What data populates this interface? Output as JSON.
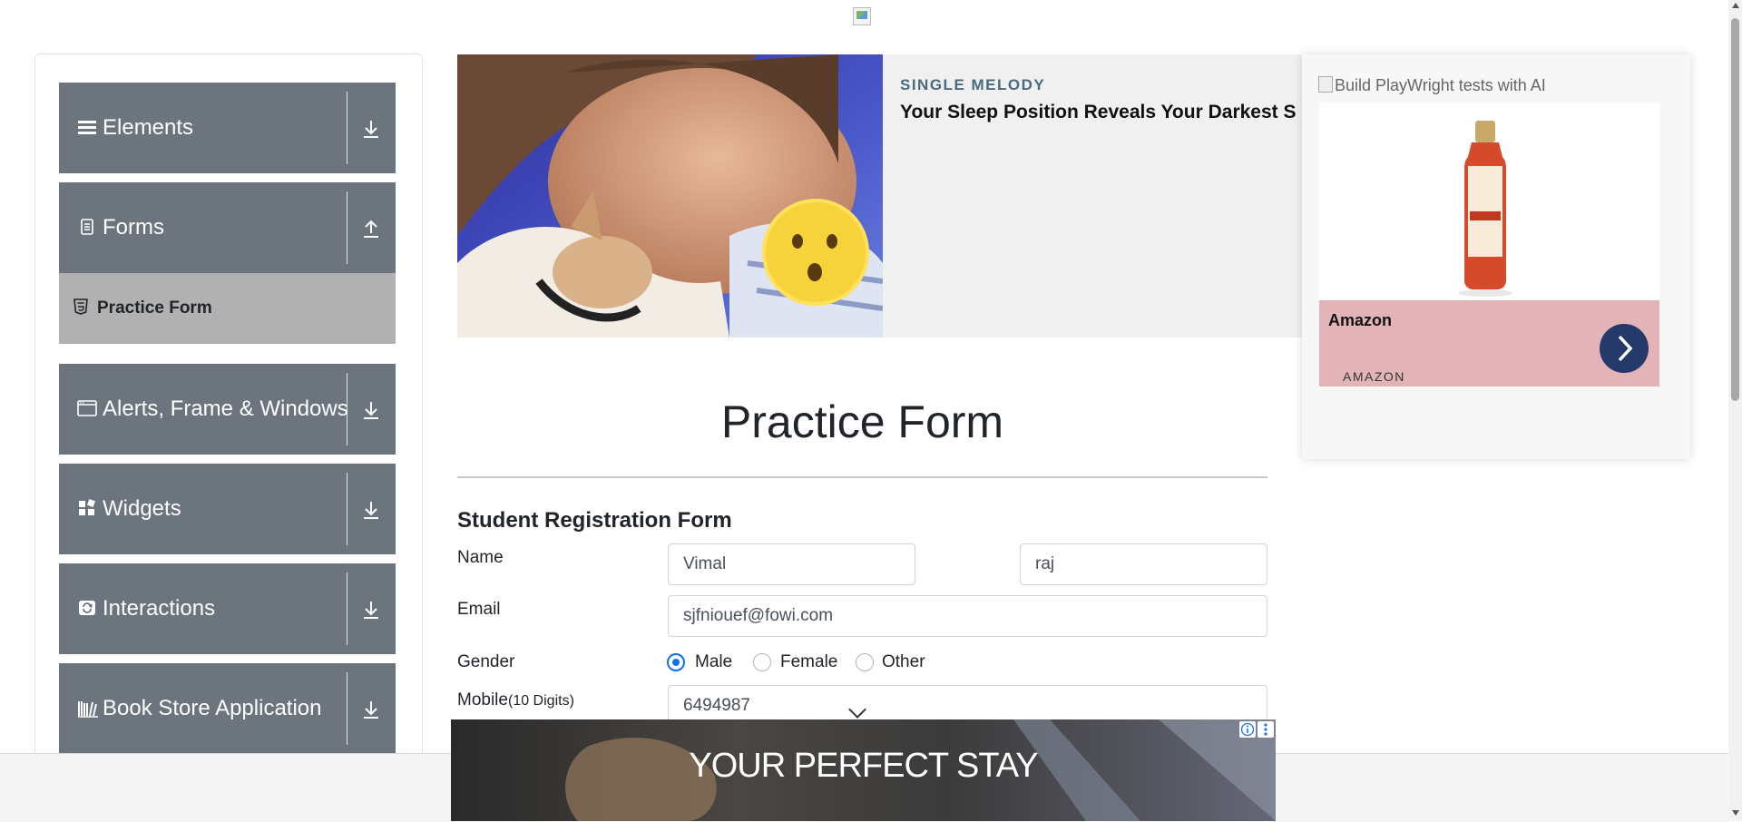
{
  "sidebar": {
    "groups": [
      {
        "label": "Elements",
        "icon": "hamburger-icon",
        "arrow": "download-arrow-icon"
      },
      {
        "label": "Forms",
        "icon": "document-icon",
        "arrow": "upload-arrow-icon"
      },
      {
        "label": "Alerts, Frame & Windows",
        "icon": "window-icon",
        "arrow": "download-arrow-icon"
      },
      {
        "label": "Widgets",
        "icon": "widgets-icon",
        "arrow": "download-arrow-icon"
      },
      {
        "label": "Interactions",
        "icon": "refresh-icon",
        "arrow": "download-arrow-icon"
      },
      {
        "label": "Book Store Application",
        "icon": "books-icon",
        "arrow": "download-arrow-icon"
      }
    ],
    "active_item": {
      "label": "Practice Form",
      "icon": "html5-icon"
    }
  },
  "banner_ad": {
    "brand": "SINGLE MELODY",
    "headline": "Your Sleep Position Reveals Your Darkest S"
  },
  "side_ad": {
    "alt_text": "Build PlayWright tests with AI",
    "product_name": "Amazon",
    "source": "AMAZON"
  },
  "page": {
    "title": "Practice Form",
    "form_heading": "Student Registration Form"
  },
  "form": {
    "name_label": "Name",
    "first_name": "Vimal",
    "last_name": "raj",
    "email_label": "Email",
    "email": "sjfniouef@fowi.com",
    "gender_label": "Gender",
    "gender_options": [
      "Male",
      "Female",
      "Other"
    ],
    "gender_selected": "Male",
    "mobile_label": "Mobile",
    "mobile_hint": "(10 Digits)",
    "mobile": "6494987"
  },
  "bottom_ad": {
    "text": "YOUR PERFECT STAY"
  },
  "colors": {
    "sidebar_group": "#6c757d",
    "active_item": "#b1b1b1",
    "radio_accent": "#0d6efd"
  }
}
